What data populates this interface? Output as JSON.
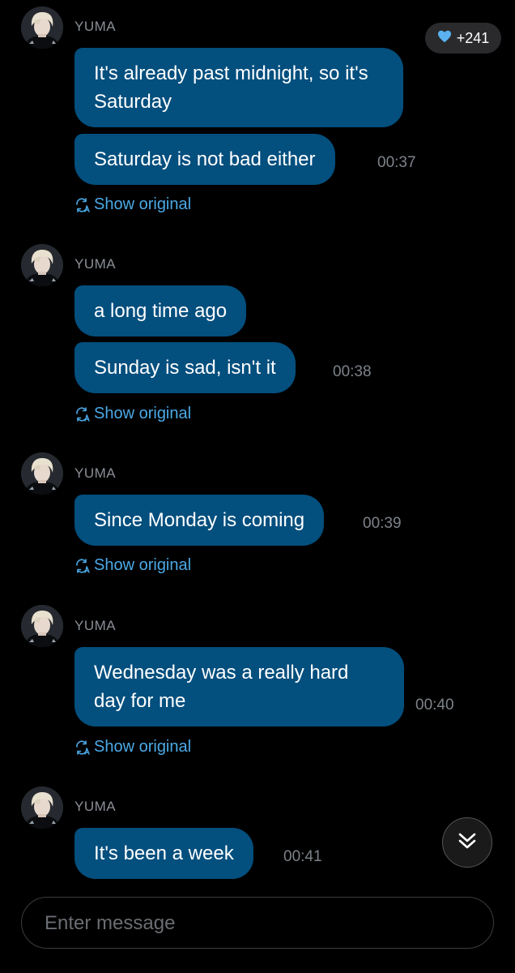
{
  "likes": {
    "icon": "heart-icon",
    "count": "+241",
    "color": "#5ab3f0"
  },
  "groups": [
    {
      "sender": "YUMA",
      "messages": [
        "It's already past midnight, so it's Saturday",
        "Saturday is not bad either"
      ],
      "time": "00:37",
      "show_original": "Show original"
    },
    {
      "sender": "YUMA",
      "messages": [
        "a long time ago",
        "Sunday is sad, isn't it"
      ],
      "time": "00:38",
      "show_original": "Show original"
    },
    {
      "sender": "YUMA",
      "messages": [
        "Since Monday is coming"
      ],
      "time": "00:39",
      "show_original": "Show original"
    },
    {
      "sender": "YUMA",
      "messages": [
        "Wednesday was a really hard day for me"
      ],
      "time": "00:40",
      "show_original": "Show original"
    },
    {
      "sender": "YUMA",
      "messages": [
        "It's been a week"
      ],
      "time": "00:41"
    }
  ],
  "scroll_button": {
    "icon": "double-chevron-down-icon"
  },
  "composer": {
    "placeholder": "Enter message"
  },
  "colors": {
    "background": "#000000",
    "bubble": "#034f7e",
    "link": "#4ba9e6",
    "timestamp": "#7d8289"
  }
}
